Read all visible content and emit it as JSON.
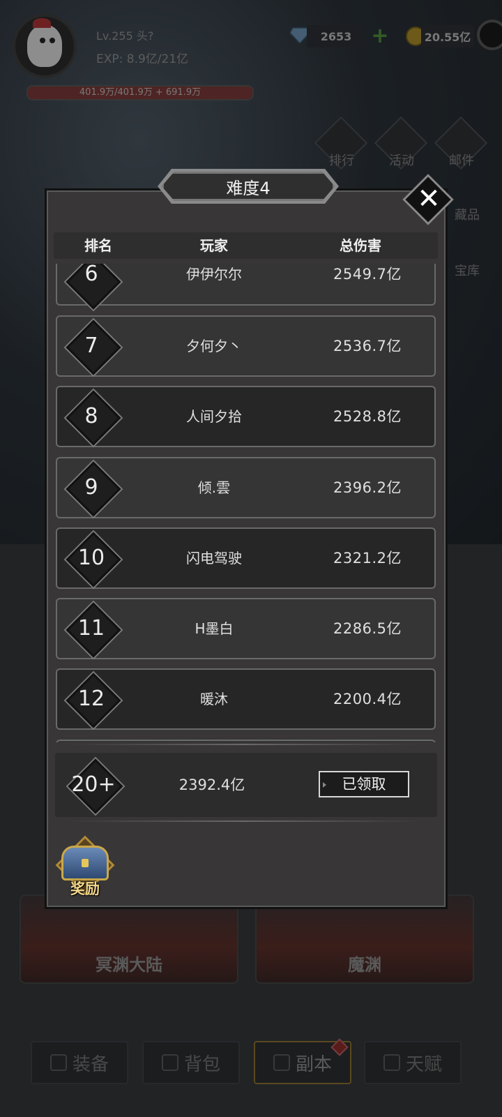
{
  "player": {
    "level": "Lv.255 头?",
    "exp": "EXP: 8.9亿/21亿",
    "hp_text": "401.9万/401.9万 + 691.9万",
    "hp_fraction": 1.0
  },
  "resources": {
    "gems": "2653",
    "gold": "20.55亿"
  },
  "side_menu": [
    "排行",
    "活动",
    "邮件",
    "藏品",
    "宝库"
  ],
  "cards": [
    "冥渊大陆",
    "魔渊"
  ],
  "bottom_nav": [
    {
      "label": "装备",
      "active": false
    },
    {
      "label": "背包",
      "active": false
    },
    {
      "label": "副本",
      "active": true
    },
    {
      "label": "天赋",
      "active": false
    }
  ],
  "modal": {
    "title": "难度4",
    "headers": {
      "rank": "排名",
      "player": "玩家",
      "damage": "总伤害"
    },
    "rows": [
      {
        "rank": "6",
        "player": "伊伊尔尔",
        "damage": "2549.7亿"
      },
      {
        "rank": "7",
        "player": "夕何夕丶",
        "damage": "2536.7亿"
      },
      {
        "rank": "8",
        "player": "人间夕拾",
        "damage": "2528.8亿"
      },
      {
        "rank": "9",
        "player": "倾.雲",
        "damage": "2396.2亿"
      },
      {
        "rank": "10",
        "player": "闪电驾驶",
        "damage": "2321.2亿"
      },
      {
        "rank": "11",
        "player": "H墨白",
        "damage": "2286.5亿"
      },
      {
        "rank": "12",
        "player": "暖沐",
        "damage": "2200.4亿"
      }
    ],
    "my_rank": {
      "rank": "20+",
      "damage": "2392.4亿",
      "button": "已领取"
    },
    "reward_label": "奖励"
  },
  "colors": {
    "accent_gold": "#b08a3a",
    "gem_plus": "#4f8f3a"
  }
}
